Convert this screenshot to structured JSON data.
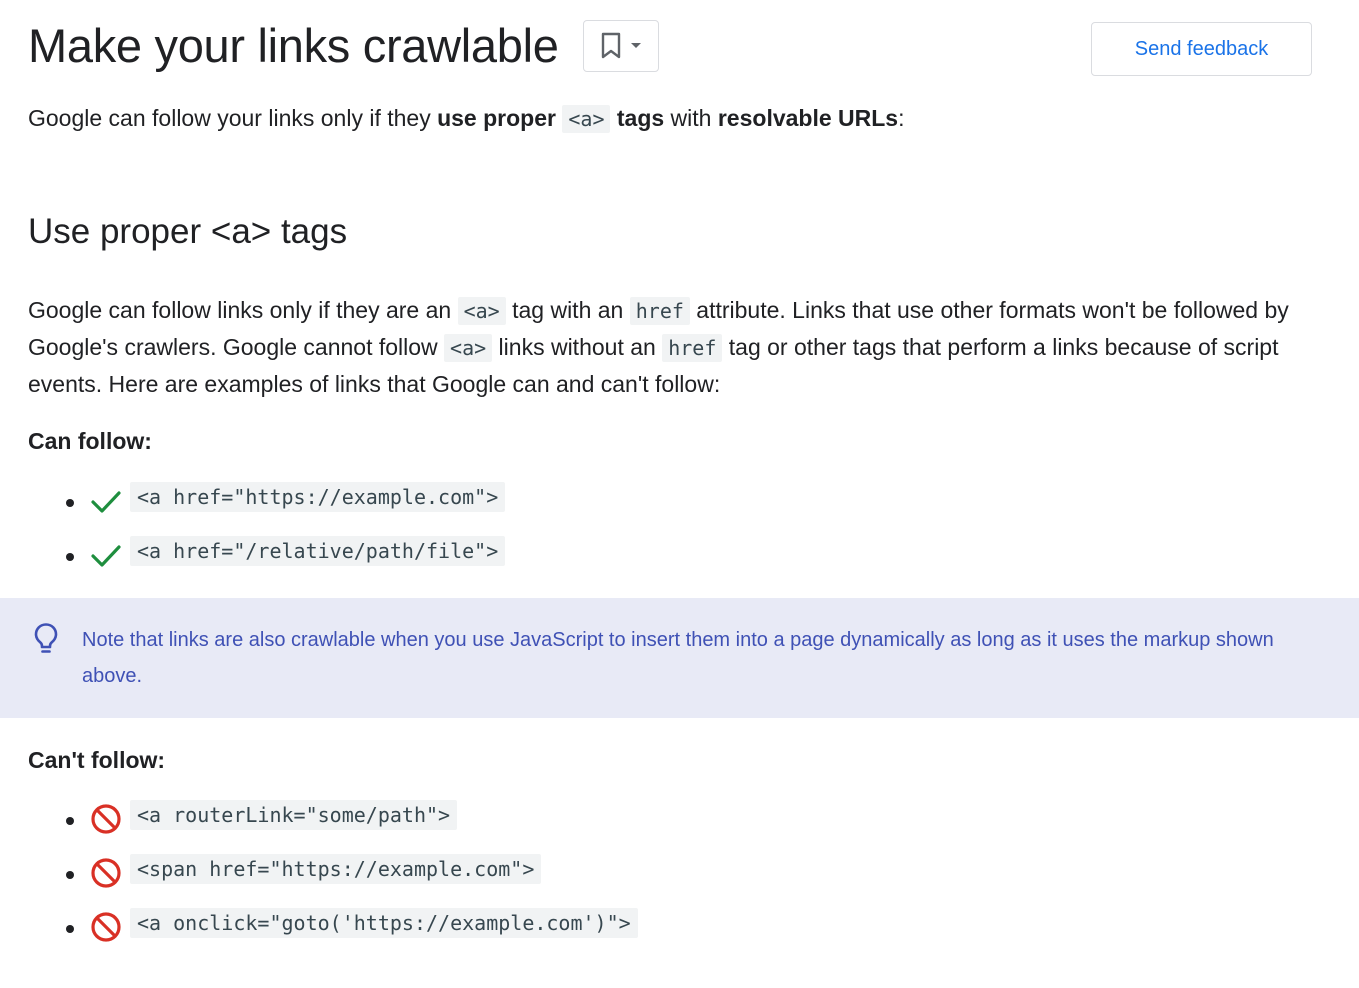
{
  "header": {
    "title": "Make your links crawlable",
    "feedback_label": "Send feedback"
  },
  "intro": {
    "prefix": "Google can follow your links only if they ",
    "bold1": "use proper ",
    "code": "<a>",
    "bold2": " tags",
    "middle": " with ",
    "bold3": "resolvable URLs",
    "suffix": ":"
  },
  "section": {
    "heading_prefix": "Use proper ",
    "heading_code": "<a>",
    "heading_suffix": " tags",
    "para": {
      "t1": "Google can follow links only if they are an ",
      "c1": "<a>",
      "t2": " tag with an ",
      "c2": "href",
      "t3": " attribute. Links that use other formats won't be followed by Google's crawlers. Google cannot follow ",
      "c3": "<a>",
      "t4": " links without an ",
      "c4": "href",
      "t5": " tag or other tags that perform a links because of script events. Here are examples of links that Google can and can't follow:"
    }
  },
  "can_follow": {
    "label": "Can follow:",
    "items": [
      {
        "code": "<a href=\"https://example.com\">",
        "icon": "checkmark-icon"
      },
      {
        "code": "<a href=\"/relative/path/file\">",
        "icon": "checkmark-icon"
      }
    ]
  },
  "note": {
    "icon": "lightbulb-icon",
    "text": "Note that links are also crawlable when you use JavaScript to insert them into a page dynamically as long as it uses the markup shown above."
  },
  "cant_follow": {
    "label": "Can't follow:",
    "items": [
      {
        "code": "<a routerLink=\"some/path\">",
        "icon": "prohibited-icon"
      },
      {
        "code": "<span href=\"https://example.com\">",
        "icon": "prohibited-icon"
      },
      {
        "code": "<a onclick=\"goto('https://example.com')\">",
        "icon": "prohibited-icon"
      }
    ]
  },
  "colors": {
    "accent": "#1a73e8",
    "check": "#1e8e3e",
    "prohibited": "#d93025",
    "note_bg": "#e8eaf6",
    "note_text": "#3f51b5"
  }
}
